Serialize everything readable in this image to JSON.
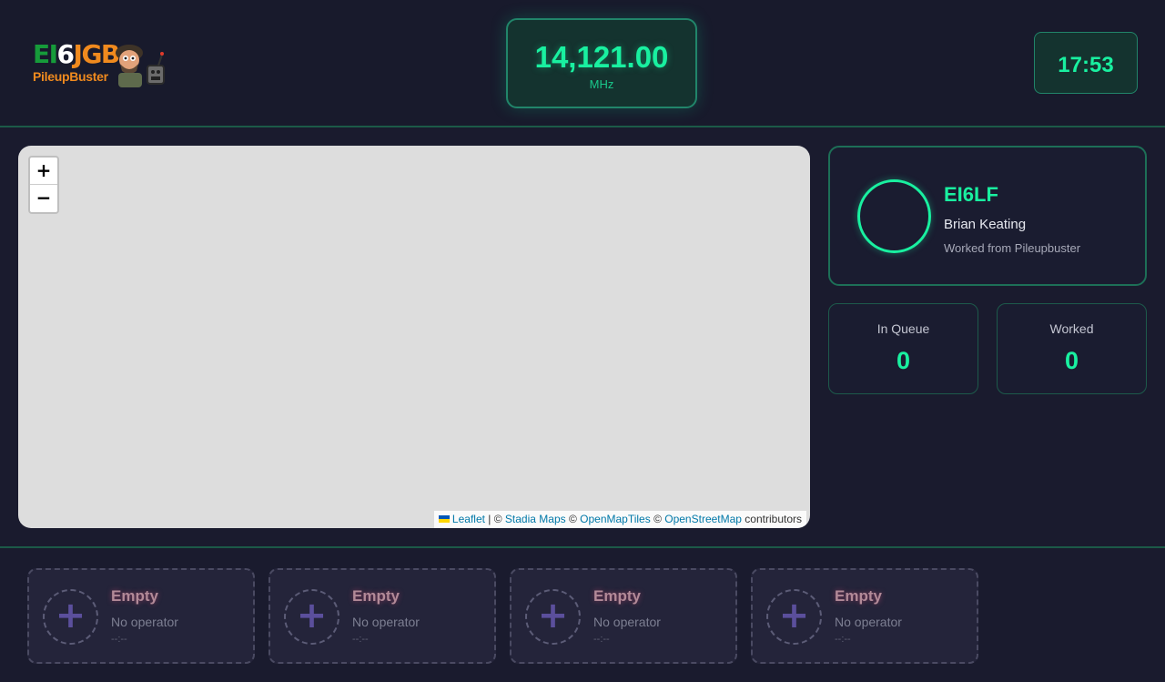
{
  "header": {
    "logo": {
      "call_part1": "EI",
      "call_part2": "6",
      "call_part3": "JGB",
      "subtitle": "PileupBuster"
    },
    "frequency": {
      "value": "14,121.00",
      "unit": "MHz"
    },
    "clock": "17:53"
  },
  "map": {
    "zoom_in": "+",
    "zoom_out": "−",
    "attribution": {
      "leaflet": "Leaflet",
      "sep1": " | © ",
      "stadia": "Stadia Maps",
      "sep2": " © ",
      "openmaptiles": "OpenMapTiles",
      "sep3": " © ",
      "osm": "OpenStreetMap",
      "suffix": " contributors"
    }
  },
  "current_operator": {
    "callsign": "EI6LF",
    "name": "Brian Keating",
    "source": "Worked from Pileupbuster"
  },
  "stats": {
    "queue": {
      "label": "In Queue",
      "value": "0"
    },
    "worked": {
      "label": "Worked",
      "value": "0"
    }
  },
  "slots": [
    {
      "title": "Empty",
      "operator": "No operator",
      "time": "--:--"
    },
    {
      "title": "Empty",
      "operator": "No operator",
      "time": "--:--"
    },
    {
      "title": "Empty",
      "operator": "No operator",
      "time": "--:--"
    },
    {
      "title": "Empty",
      "operator": "No operator",
      "time": "--:--"
    }
  ],
  "colors": {
    "accent": "#19f0a0",
    "background": "#1a1b2e",
    "border": "#1d6f57"
  }
}
